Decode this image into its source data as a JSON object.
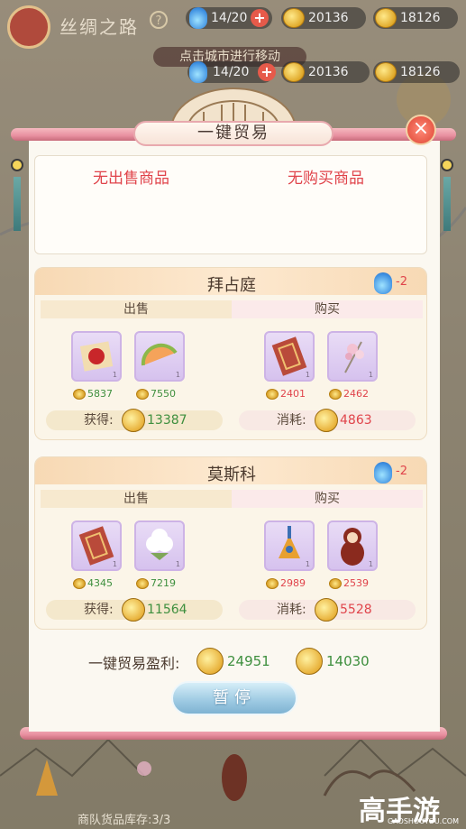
{
  "top_bar": {
    "title": "丝绸之路",
    "help_icon": "?",
    "stamina": "14/20",
    "coins": "20136",
    "gold": "18126",
    "hint": "点击城市进行移动"
  },
  "resources": {
    "stamina": "14/20",
    "coins": "20136",
    "gold": "18126"
  },
  "dialog": {
    "title": "一键贸易",
    "close_icon": "×",
    "no_sell": "无出售商品",
    "no_buy": "无购买商品"
  },
  "cities": [
    {
      "name": "拜占庭",
      "stamina_cost": "-2",
      "sell_tab": "出售",
      "buy_tab": "购买",
      "sell_items": [
        {
          "icon": "sealed-letter-icon",
          "qty": "1",
          "price": "5837"
        },
        {
          "icon": "melon-icon",
          "qty": "1",
          "price": "7550"
        }
      ],
      "buy_items": [
        {
          "icon": "carpet-icon",
          "qty": "1",
          "price": "2401"
        },
        {
          "icon": "flower-hairpin-icon",
          "qty": "1",
          "price": "2462"
        }
      ],
      "gain_label": "获得:",
      "gain_value": "13387",
      "spend_label": "消耗:",
      "spend_value": "4863"
    },
    {
      "name": "莫斯科",
      "stamina_cost": "-2",
      "sell_tab": "出售",
      "buy_tab": "购买",
      "sell_items": [
        {
          "icon": "carpet-icon",
          "qty": "1",
          "price": "4345"
        },
        {
          "icon": "cotton-icon",
          "qty": "1",
          "price": "7219"
        }
      ],
      "buy_items": [
        {
          "icon": "balalaika-icon",
          "qty": "1",
          "price": "2989"
        },
        {
          "icon": "matryoshka-icon",
          "qty": "1",
          "price": "2539"
        }
      ],
      "gain_label": "获得:",
      "gain_value": "11564",
      "spend_label": "消耗:",
      "spend_value": "5528"
    }
  ],
  "profit": {
    "label": "一键贸易盈利:",
    "coins": "24951",
    "gold": "14030"
  },
  "pause_button": "暂停",
  "caravan_stock": "商队货品库存:3/3",
  "watermark": {
    "text": "高手游",
    "url": "GAOSHOUYOU.COM"
  },
  "colors": {
    "sell_green": "#3e8f3e",
    "buy_red": "#e0444b",
    "accent_pink": "#e890a0"
  }
}
